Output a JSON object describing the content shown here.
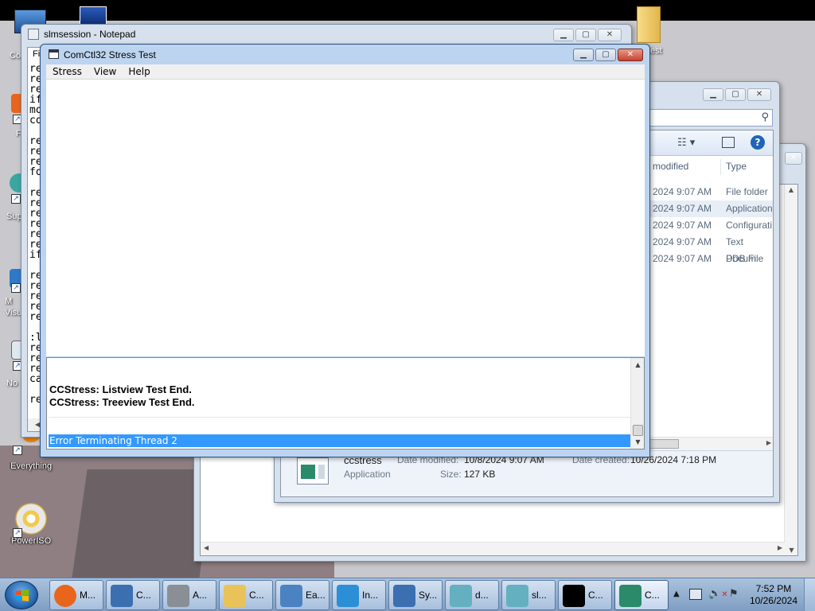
{
  "desktop": {
    "icons": [
      {
        "label": "Co",
        "name": "computer"
      },
      {
        "label": "F",
        "name": "app-f"
      },
      {
        "label": "Sup",
        "name": "support"
      },
      {
        "label": "M\nVisu",
        "name": "visual-studio"
      },
      {
        "label": "No",
        "name": "notepad-shortcut"
      },
      {
        "label": "Everything",
        "name": "everything"
      },
      {
        "label": "PowerISO",
        "name": "poweriso"
      },
      {
        "label": "test",
        "name": "test-folder"
      }
    ]
  },
  "notepad": {
    "title": "slmsession - Notepad",
    "menu_first": "Fi",
    "lines": [
      "re",
      "re",
      "re",
      "if",
      "mo",
      "co",
      "",
      "re",
      "re",
      "re",
      "fo",
      "",
      "re",
      "re",
      "re",
      "re",
      "re",
      "re",
      "if",
      "",
      "re",
      "re",
      "re",
      "re",
      "re",
      "",
      ":l",
      "re",
      "re",
      "re",
      "ca",
      "",
      "re"
    ]
  },
  "explorer": {
    "columns": {
      "modified": "modified",
      "type": "Type"
    },
    "rows": [
      {
        "date": "2024 9:07 AM",
        "type": "File folder"
      },
      {
        "date": "2024 9:07 AM",
        "type": "Application"
      },
      {
        "date": "2024 9:07 AM",
        "type": "Configurati"
      },
      {
        "date": "2024 9:07 AM",
        "type": "Text Docum"
      },
      {
        "date": "2024 9:07 AM",
        "type": "PDB File"
      }
    ],
    "details": {
      "name": "ccstress",
      "kind": "Application",
      "date_modified_label": "Date modified:",
      "date_modified": "10/8/2024 9:07 AM",
      "date_created_label": "Date created:",
      "date_created": "10/26/2024 7:18 PM",
      "size_label": "Size:",
      "size": "127 KB"
    }
  },
  "stress": {
    "title": "ComCtl32 Stress Test",
    "menu": [
      "Stress",
      "View",
      "Help"
    ],
    "log": [
      {
        "text": "",
        "selected": false
      },
      {
        "text": "CCStress: Listview Test End.",
        "selected": false
      },
      {
        "text": "CCStress: Treeview Test End.",
        "selected": false
      },
      {
        "text": "",
        "selected": false
      },
      {
        "text": "Error Terminating Thread 2",
        "selected": true
      }
    ]
  },
  "taskbar": {
    "buttons": [
      {
        "label": "M...",
        "icon": "firefox-icon",
        "color": "#e8661c"
      },
      {
        "label": "C...",
        "icon": "computer-icon",
        "color": "#3b6fb0"
      },
      {
        "label": "A...",
        "icon": "printer-icon",
        "color": "#8a8f96"
      },
      {
        "label": "C...",
        "icon": "folder-icon",
        "color": "#e9c35a"
      },
      {
        "label": "Ea...",
        "icon": "installer-icon",
        "color": "#4b82c2"
      },
      {
        "label": "In...",
        "icon": "windows-update-icon",
        "color": "#2c8fd6"
      },
      {
        "label": "Sy...",
        "icon": "system-icon",
        "color": "#3b6fb0"
      },
      {
        "label": "d...",
        "icon": "notepad-icon",
        "color": "#64b0c0"
      },
      {
        "label": "sl...",
        "icon": "notepad-icon",
        "color": "#64b0c0"
      },
      {
        "label": "C...",
        "icon": "cmd-icon",
        "color": "#000000"
      },
      {
        "label": "C...",
        "icon": "app-window-icon",
        "color": "#2a8a6a"
      }
    ],
    "time": "7:52 PM",
    "date": "10/26/2024"
  },
  "colors": {
    "selection": "#3399ff",
    "title_active": "#bcd4ef",
    "close_button": "#c7432e"
  }
}
